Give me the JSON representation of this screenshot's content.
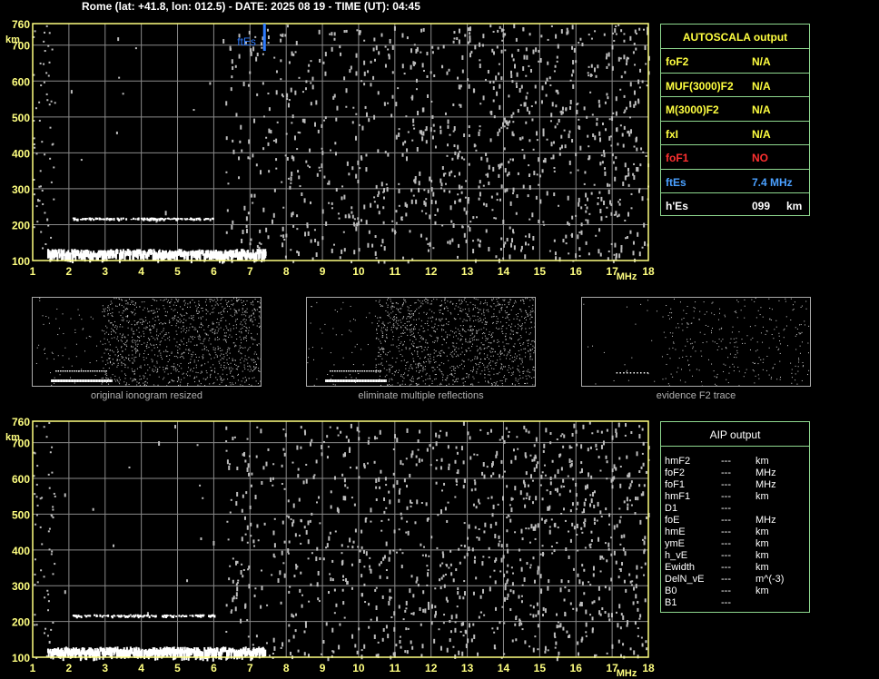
{
  "header": {
    "title": "Rome (lat: +41.8, lon: 012.5) - DATE: 2025 08 19 - TIME (UT): 04:45"
  },
  "colors": {
    "axis": "#ffff80",
    "grid": "#8a8a8a",
    "trace": "#ffffff",
    "noise": "#bdbdbd",
    "ftEs_marker": "#2f7cff",
    "panel_border": "#8fd98f",
    "autoscala_label": "#ffff40",
    "fof1_color": "#ff3030",
    "ftes_color": "#4aa0ff"
  },
  "chart_data": [
    {
      "type": "scatter",
      "name": "ionogram-autoscala",
      "x_ticks": [
        1,
        2,
        3,
        4,
        5,
        6,
        7,
        8,
        9,
        10,
        11,
        12,
        13,
        14,
        15,
        16,
        17,
        18
      ],
      "y_ticks": [
        100,
        200,
        300,
        400,
        500,
        600,
        700,
        760
      ],
      "xlim": [
        1,
        18
      ],
      "ylim": [
        100,
        760
      ],
      "x_unit": "MHz",
      "y_unit": "km",
      "grid": true,
      "marker": {
        "label": "ftEs",
        "x": 7.4
      },
      "traces": [
        {
          "name": "E-trace",
          "x_start": 1.4,
          "x_end": 7.4,
          "h": 115
        },
        {
          "name": "multiple-reflection",
          "x_start": 2.1,
          "x_end": 6.0,
          "h": 215
        }
      ]
    },
    {
      "type": "scatter",
      "name": "ionogram-aip",
      "x_ticks": [
        1,
        2,
        3,
        4,
        5,
        6,
        7,
        8,
        9,
        10,
        11,
        12,
        13,
        14,
        15,
        16,
        17,
        18
      ],
      "y_ticks": [
        100,
        200,
        300,
        400,
        500,
        600,
        700,
        760
      ],
      "xlim": [
        1,
        18
      ],
      "ylim": [
        100,
        760
      ],
      "x_unit": "MHz",
      "y_unit": "km",
      "grid": true,
      "traces": [
        {
          "name": "E-trace",
          "x_start": 1.4,
          "x_end": 7.4,
          "h": 112
        },
        {
          "name": "multiple-reflection",
          "x_start": 2.1,
          "x_end": 6.0,
          "h": 215
        }
      ]
    }
  ],
  "autoscala": {
    "title": "AUTOSCALA output",
    "rows": [
      {
        "label": "foF2",
        "value": "N/A",
        "unit": "",
        "color": "#ffff40"
      },
      {
        "label": "MUF(3000)F2",
        "value": "N/A",
        "unit": "",
        "color": "#ffff40"
      },
      {
        "label": "M(3000)F2",
        "value": "N/A",
        "unit": "",
        "color": "#ffff40"
      },
      {
        "label": "fxI",
        "value": "N/A",
        "unit": "",
        "color": "#ffff40"
      },
      {
        "label": "foF1",
        "value": "NO",
        "unit": "",
        "color": "#ff3030"
      },
      {
        "label": "ftEs",
        "value": "7.4 MHz",
        "unit": "",
        "color": "#4aa0ff"
      },
      {
        "label": "h'Es",
        "value": "099",
        "unit": "km",
        "color": "#ffffff"
      }
    ]
  },
  "thumbnails": [
    {
      "caption": "original ionogram resized"
    },
    {
      "caption": "eliminate multiple reflections"
    },
    {
      "caption": "evidence F2 trace"
    }
  ],
  "aip": {
    "title": "AIP output",
    "rows": [
      {
        "param": "hmF2",
        "value": "---",
        "unit": "km"
      },
      {
        "param": "foF2",
        "value": "---",
        "unit": "MHz"
      },
      {
        "param": "foF1",
        "value": "---",
        "unit": "MHz"
      },
      {
        "param": "hmF1",
        "value": "---",
        "unit": "km"
      },
      {
        "param": "D1",
        "value": "---",
        "unit": ""
      },
      {
        "param": "foE",
        "value": "---",
        "unit": "MHz"
      },
      {
        "param": "hmE",
        "value": "---",
        "unit": "km"
      },
      {
        "param": "ymE",
        "value": "---",
        "unit": "km"
      },
      {
        "param": "h_vE",
        "value": "---",
        "unit": "km"
      },
      {
        "param": "Ewidth",
        "value": "---",
        "unit": "km"
      },
      {
        "param": "DelN_vE",
        "value": "---",
        "unit": "m^(-3)"
      },
      {
        "param": "B0",
        "value": "---",
        "unit": "km"
      },
      {
        "param": "B1",
        "value": "---",
        "unit": ""
      }
    ]
  }
}
